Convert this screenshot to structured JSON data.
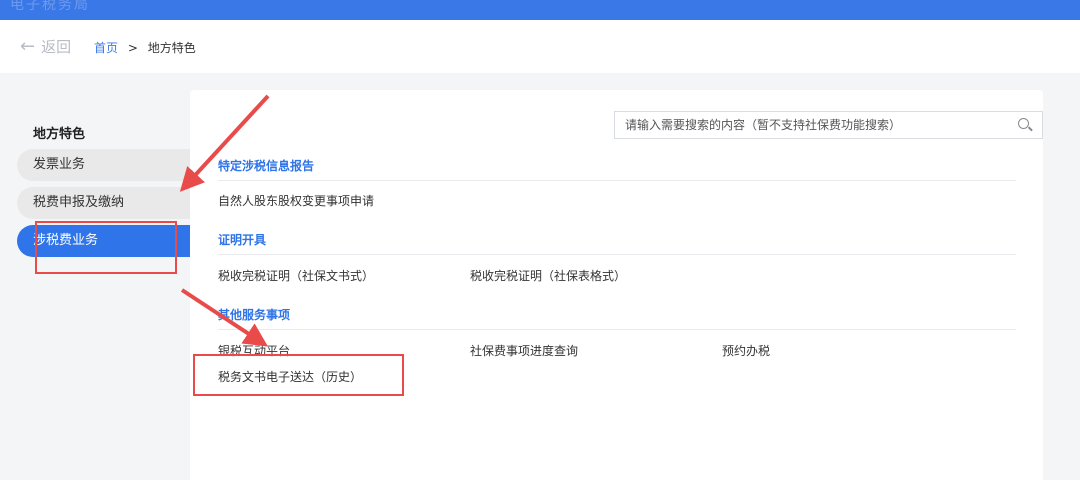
{
  "topbar": {
    "faint_title": "电子税务局"
  },
  "navbar": {
    "back_label": "返回",
    "breadcrumb": {
      "home": "首页",
      "separator": ">",
      "current": "地方特色"
    }
  },
  "sidebar": {
    "title": "地方特色",
    "items": [
      {
        "label": "发票业务",
        "active": false
      },
      {
        "label": "税费申报及缴纳",
        "active": false
      },
      {
        "label": "涉税费业务",
        "active": true
      }
    ]
  },
  "search": {
    "placeholder": "请输入需要搜索的内容（暂不支持社保费功能搜索）",
    "value": ""
  },
  "sections": [
    {
      "title": "特定涉税信息报告",
      "items": [
        "自然人股东股权变更事项申请"
      ]
    },
    {
      "title": "证明开具",
      "items": [
        "税收完税证明（社保文书式）",
        "税收完税证明（社保表格式）"
      ]
    },
    {
      "title": "其他服务事项",
      "items": [
        "银税互动平台",
        "社保费事项进度查询",
        "预约办税",
        "税务文书电子送达（历史）"
      ]
    }
  ],
  "colors": {
    "accent": "#2f74e8",
    "topbar": "#3b78e7",
    "annotation": "#e94a4a"
  }
}
